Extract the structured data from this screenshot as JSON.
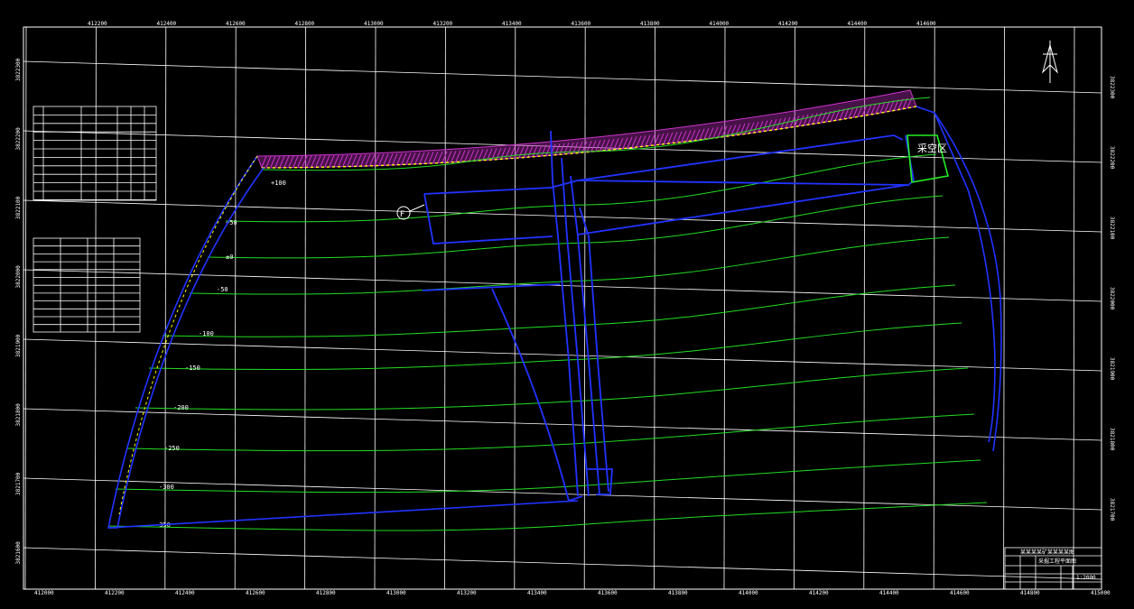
{
  "drawing": {
    "top_coords": [
      "412200",
      "412400",
      "412600",
      "412800",
      "413000",
      "413200",
      "413400",
      "413600",
      "413800",
      "414000",
      "414200",
      "414400",
      "414600"
    ],
    "bottom_coords": [
      "412000",
      "412200",
      "412400",
      "412600",
      "412800",
      "413000",
      "413200",
      "413400",
      "413600",
      "413800",
      "414000",
      "414200",
      "414400",
      "414600",
      "414800",
      "415000"
    ],
    "left_coords": [
      "3822300",
      "3822200",
      "3822100",
      "3822000",
      "3821900",
      "3821800",
      "3821700",
      "3821600"
    ],
    "right_coords": [
      "3822300",
      "3822200",
      "3822100",
      "3822000",
      "3821900",
      "3821800",
      "3821700"
    ],
    "contour_labels": [
      "+100",
      "+50",
      "±0",
      "-50",
      "-100",
      "-150",
      "-200",
      "-250",
      "-300",
      "-350"
    ],
    "zone_label": "采空区",
    "circle_label": "F",
    "north_arrow": "north-arrow-icon",
    "colors": {
      "grid": "#ffffff",
      "contour": "#22dd22",
      "boundary": "#2233ff",
      "hatch": "#cc33cc",
      "outcrop": "#ffff00"
    }
  },
  "title_block": {
    "title": "某某某某矿某某某某图",
    "drawing_name": "采掘工程平面图",
    "scale": "1:2000"
  }
}
